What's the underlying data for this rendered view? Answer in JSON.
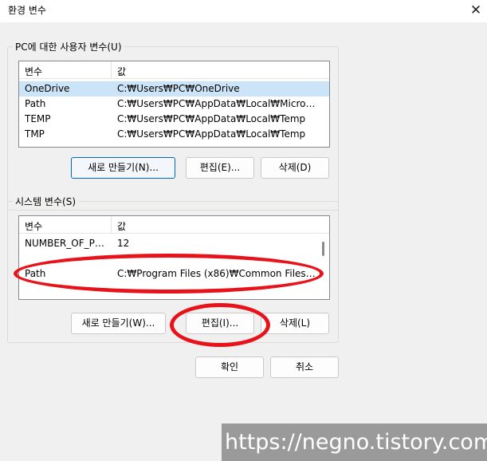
{
  "window": {
    "title": "환경 변수",
    "close_glyph": "✕"
  },
  "user_vars": {
    "group_title": "PC에 대한 사용자 변수(U)",
    "headers": {
      "name": "변수",
      "value": "값"
    },
    "rows": [
      {
        "name": "OneDrive",
        "value": "C:₩Users₩PC₩OneDrive",
        "selected": true
      },
      {
        "name": "Path",
        "value": "C:₩Users₩PC₩AppData₩Local₩Microsoft₩...",
        "selected": false
      },
      {
        "name": "TEMP",
        "value": "C:₩Users₩PC₩AppData₩Local₩Temp",
        "selected": false
      },
      {
        "name": "TMP",
        "value": "C:₩Users₩PC₩AppData₩Local₩Temp",
        "selected": false
      }
    ],
    "buttons": {
      "new": "새로 만들기(N)...",
      "edit": "편집(E)...",
      "delete": "삭제(D)"
    }
  },
  "system_vars": {
    "group_title": "시스템 변수(S)",
    "headers": {
      "name": "변수",
      "value": "값"
    },
    "rows": [
      {
        "name": "NUMBER_OF_PRO...",
        "value": "12",
        "selected": false
      },
      {
        "name": "Path",
        "value": "C:₩Program Files (x86)₩Common Files₩Or...",
        "selected": false
      }
    ],
    "buttons": {
      "new": "새로 만들기(W)...",
      "edit": "편집(I)...",
      "delete": "삭제(L)"
    }
  },
  "footer": {
    "ok": "확인",
    "cancel": "취소"
  },
  "watermark": "https://negno.tistory.com",
  "colors": {
    "highlight_red": "#e8121a",
    "selection_blue": "#cce4f7",
    "default_button_border": "#0067c0"
  }
}
